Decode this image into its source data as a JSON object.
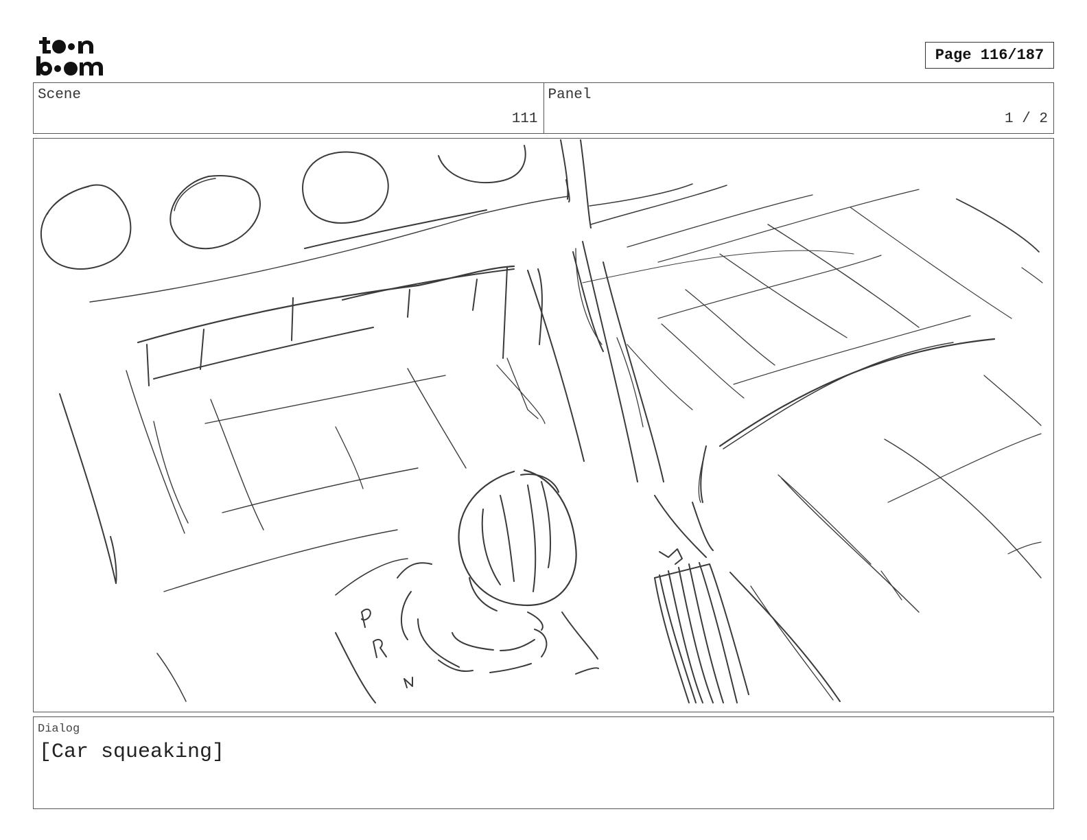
{
  "header": {
    "logo_text": "toonboom",
    "page_label": "Page 116/187"
  },
  "info": {
    "scene_label": "Scene",
    "scene_value": "111",
    "panel_label": "Panel",
    "panel_value": "1 / 2"
  },
  "dialog": {
    "label": "Dialog",
    "text": "[Car squeaking]"
  },
  "sketch": {
    "subject": "car interior dashboard with gear shift",
    "gear_letters": [
      "P",
      "R",
      "N"
    ],
    "line_color": "#3a3a3a"
  }
}
